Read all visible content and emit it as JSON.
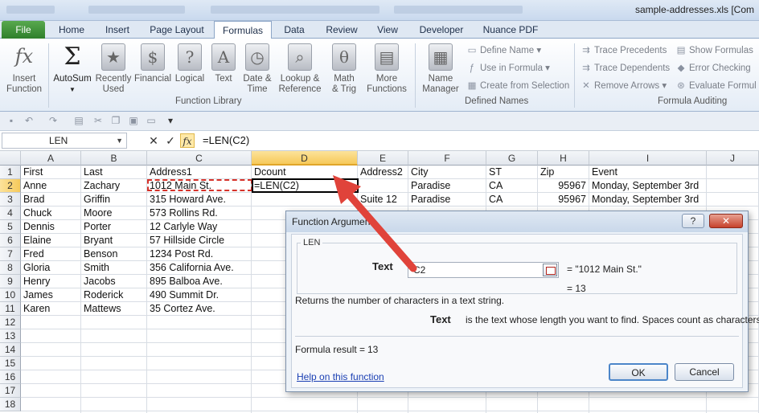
{
  "window": {
    "title": "sample-addresses.xls  [Com"
  },
  "tabs": [
    "File",
    "Home",
    "Insert",
    "Page Layout",
    "Formulas",
    "Data",
    "Review",
    "View",
    "Developer",
    "Nuance PDF"
  ],
  "active_tab": "Formulas",
  "ribbon": {
    "insert_function": {
      "icon": "fx",
      "line1": "Insert",
      "line2": "Function"
    },
    "autosum": {
      "icon": "Σ",
      "label": "AutoSum"
    },
    "recently_used": {
      "line1": "Recently",
      "line2": "Used"
    },
    "financial": {
      "label": "Financial"
    },
    "logical": {
      "label": "Logical"
    },
    "text": {
      "label": "Text"
    },
    "date_time": {
      "line1": "Date &",
      "line2": "Time"
    },
    "lookup": {
      "line1": "Lookup &",
      "line2": "Reference"
    },
    "math": {
      "line1": "Math",
      "line2": "& Trig"
    },
    "more": {
      "line1": "More",
      "line2": "Functions"
    },
    "function_library_label": "Function Library",
    "name_manager": {
      "line1": "Name",
      "line2": "Manager"
    },
    "define_name": "Define Name",
    "use_in_formula": "Use in Formula",
    "create_from_selection": "Create from Selection",
    "defined_names_label": "Defined Names",
    "trace_precedents": "Trace Precedents",
    "trace_dependents": "Trace Dependents",
    "remove_arrows": "Remove Arrows",
    "show_formulas": "Show Formulas",
    "error_checking": "Error Checking",
    "evaluate_formula": "Evaluate Formul",
    "formula_auditing_label": "Formula Auditing"
  },
  "formula_bar": {
    "name_box": "LEN",
    "cancel": "✕",
    "enter": "✓",
    "fx": "fx",
    "formula": "=LEN(C2)"
  },
  "columns": [
    "A",
    "B",
    "C",
    "D",
    "E",
    "F",
    "G",
    "H",
    "I",
    "J"
  ],
  "rows": [
    "1",
    "2",
    "3",
    "4",
    "5",
    "6",
    "7",
    "8",
    "9",
    "10",
    "11",
    "12",
    "13",
    "14",
    "15",
    "16",
    "17",
    "18"
  ],
  "sheet": {
    "header": [
      "First",
      "Last",
      "Address1",
      "Dcount",
      "Address2",
      "City",
      "ST",
      "Zip",
      "Event"
    ],
    "data": [
      [
        "Anne",
        "Zachary",
        "1012 Main St.",
        "=LEN(C2)",
        "",
        "Paradise",
        "CA",
        "95967",
        "Monday, September 3rd"
      ],
      [
        "Brad",
        "Griffin",
        "315 Howard Ave.",
        "",
        "Suite 12",
        "Paradise",
        "CA",
        "95967",
        "Monday, September 3rd"
      ],
      [
        "Chuck",
        "Moore",
        "573 Rollins Rd.",
        "",
        "",
        "",
        "",
        "",
        ""
      ],
      [
        "Dennis",
        "Porter",
        "12 Carlyle Way",
        "",
        "",
        "",
        "",
        "",
        ""
      ],
      [
        "Elaine",
        "Bryant",
        "57 Hillside Circle",
        "",
        "",
        "",
        "",
        "",
        ""
      ],
      [
        "Fred",
        "Benson",
        "1234 Post Rd.",
        "",
        "",
        "",
        "",
        "",
        ""
      ],
      [
        "Gloria",
        "Smith",
        "356 California Ave.",
        "",
        "",
        "",
        "",
        "",
        ""
      ],
      [
        "Henry",
        "Jacobs",
        "895 Balboa Ave.",
        "",
        "",
        "",
        "",
        "",
        ""
      ],
      [
        "James",
        "Roderick",
        "490 Summit Dr.",
        "",
        "",
        "",
        "",
        "",
        ""
      ],
      [
        "Karen",
        "Mattews",
        "35 Cortez Ave.",
        "",
        "",
        "",
        "",
        "",
        ""
      ]
    ]
  },
  "dialog": {
    "title": "Function Argument",
    "help_btn": "?",
    "close_btn": "✕",
    "function_name": "LEN",
    "arg_label": "Text",
    "arg_value": "C2",
    "arg_result": "=  \"1012 Main St.\"",
    "result_eq": "=  13",
    "description": "Returns the number of characters in a text string.",
    "arg_desc_label": "Text",
    "arg_desc": "is the text whose length you want to find. Spaces count as characters.",
    "formula_result_label": "Formula result =",
    "formula_result_value": "13",
    "help_link": "Help on this function",
    "ok": "OK",
    "cancel": "Cancel"
  },
  "colors": {
    "accent_red": "#e0433a",
    "selection_gold": "#f6c95a",
    "file_green": "#2f7f2b"
  }
}
